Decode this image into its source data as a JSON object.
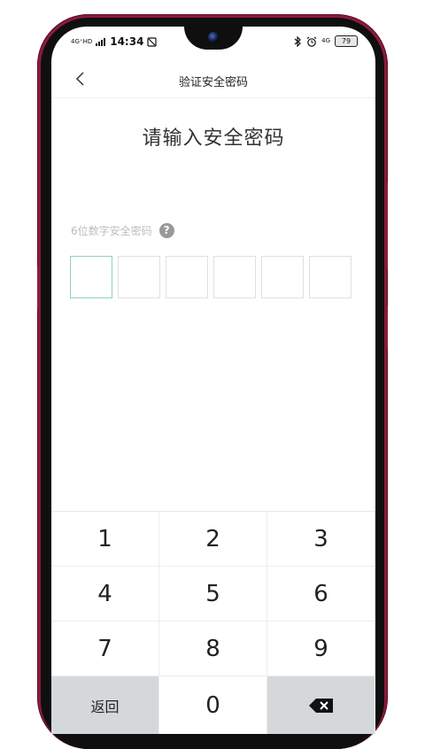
{
  "status_bar": {
    "signal_label": "4G⁺HD",
    "time": "14:34",
    "network": "4G",
    "battery": "79"
  },
  "header": {
    "title": "验证安全密码"
  },
  "main": {
    "heading": "请输入安全密码",
    "hint": "6位数字安全密码",
    "help_icon_text": "?"
  },
  "keypad": {
    "keys": [
      "1",
      "2",
      "3",
      "4",
      "5",
      "6",
      "7",
      "8",
      "9"
    ],
    "return_label": "返回",
    "zero": "0"
  },
  "colors": {
    "phone_frame": "#8c1b3a",
    "active_box_border": "#8fd0c4",
    "gray_key": "#d5d8db"
  }
}
